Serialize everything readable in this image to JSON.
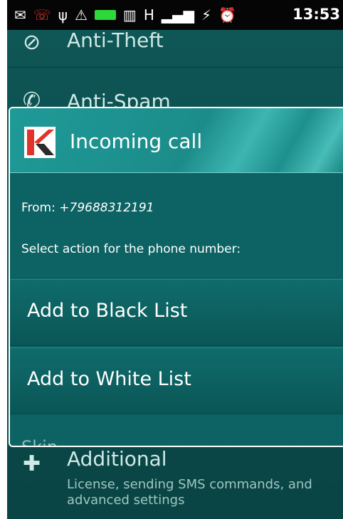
{
  "status_bar": {
    "time": "13:53",
    "icons": [
      "message-icon",
      "missed-call-icon",
      "usb-icon",
      "warning-icon",
      "battery-green-icon",
      "vibrate-icon",
      "data-transfer-icon",
      "signal-icon",
      "battery-icon",
      "alarm-icon"
    ]
  },
  "background": {
    "items": [
      {
        "title": "Anti-Theft",
        "icon": "anti-theft-icon"
      },
      {
        "title": "Anti-Spam",
        "icon": "phone-icon"
      },
      {
        "title": "Additional",
        "subtitle": "License, sending SMS commands, and advanced settings",
        "icon": "puzzle-icon"
      }
    ]
  },
  "dialog": {
    "title": "Incoming call",
    "from_label": "From:",
    "from_number": "+79688312191",
    "prompt": "Select action for the phone number:",
    "actions": [
      {
        "label": "Add to Black List"
      },
      {
        "label": "Add to White List"
      }
    ],
    "skip_label": "Skip",
    "colors": {
      "header": "#1e9a98",
      "body": "#0d6363",
      "border": "#ffffff"
    }
  }
}
